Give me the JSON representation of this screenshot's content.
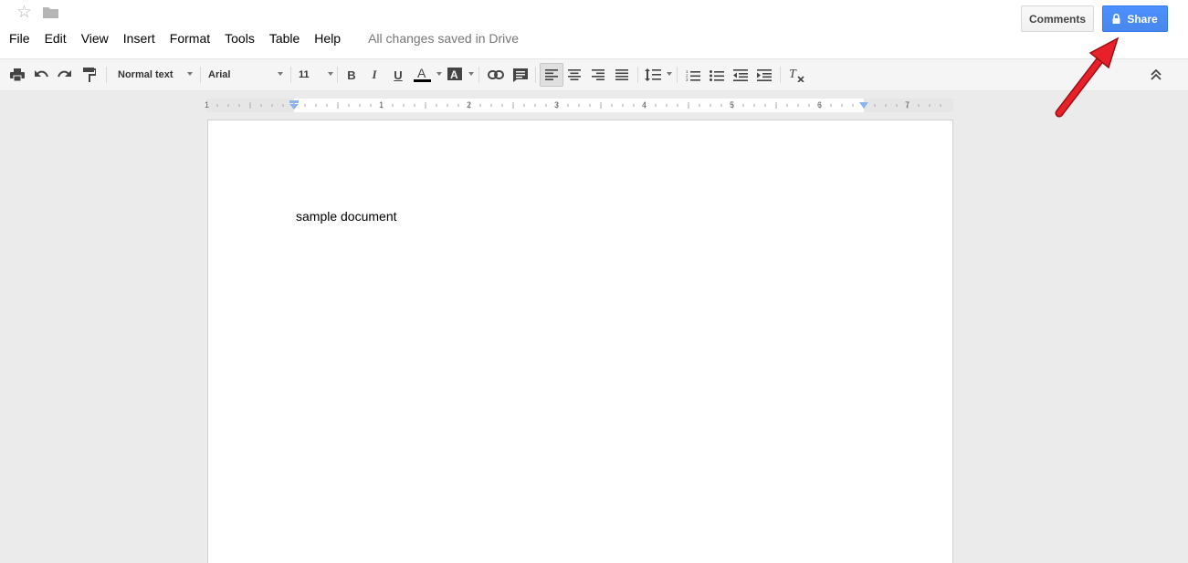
{
  "header": {
    "icons": {
      "star": "star-icon",
      "folder": "folder-icon"
    },
    "menu": [
      "File",
      "Edit",
      "View",
      "Insert",
      "Format",
      "Tools",
      "Table",
      "Help"
    ],
    "save_status": "All changes saved in Drive",
    "comments_label": "Comments",
    "share_label": "Share"
  },
  "toolbar": {
    "style_value": "Normal text",
    "font_value": "Arial",
    "size_value": "11"
  },
  "ruler": {
    "numbers": [
      "1",
      "1",
      "2",
      "3",
      "4",
      "5",
      "6",
      "7"
    ]
  },
  "document": {
    "text": "sample document"
  },
  "colors": {
    "share_blue": "#4d90fe",
    "annotation_red": "#e8202a",
    "canvas_bg": "#ebebeb"
  }
}
